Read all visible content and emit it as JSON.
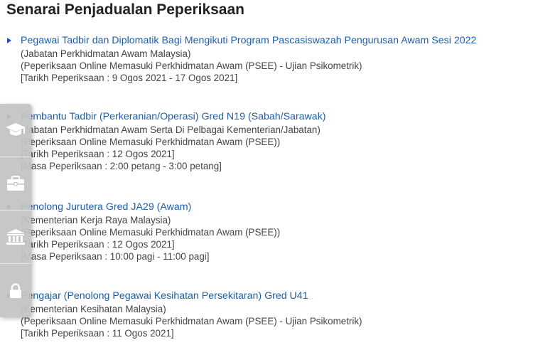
{
  "page": {
    "title": "Senarai Penjadualan Peperiksaan"
  },
  "exams": [
    {
      "title": "Pegawai Tadbir dan Diplomatik Bagi Mengikuti Program Pascasiswazah Pengurusan Awam Sesi 2022",
      "agency": "(Jabatan Perkhidmatan Awam Malaysia)",
      "exam_type": "(Peperiksaan Online Memasuki Perkhidmatan Awam (PSEE) - Ujian Psikometrik)",
      "date": "[Tarikh Peperiksaan : 9 Ogos 2021 - 17 Ogos 2021]",
      "time": ""
    },
    {
      "title": "Pembantu Tadbir (Perkeranian/Operasi) Gred N19 (Sabah/Sarawak)",
      "agency": "(Jabatan Perkhidmatan Awam Serta Di Pelbagai Kementerian/Jabatan)",
      "exam_type": "(Peperiksaan Online Memasuki Perkhidmatan Awam (PSEE))",
      "date": "[Tarikh Peperiksaan : 12 Ogos 2021]",
      "time": "[Masa Peperiksaan : 2:00 petang - 3:00 petang]"
    },
    {
      "title": "Penolong Jurutera Gred JA29 (Awam)",
      "agency": "(Kementerian Kerja Raya Malaysia)",
      "exam_type": "(Peperiksaan Online Memasuki Perkhidmatan Awam (PSEE))",
      "date": "[Tarikh Peperiksaan : 12 Ogos 2021]",
      "time": "[Masa Peperiksaan : 10:00 pagi - 11:00 pagi]"
    },
    {
      "title": "Pengajar (Penolong Pegawai Kesihatan Persekitaran) Gred U41",
      "agency": "(Kementerian Kesihatan Malaysia)",
      "exam_type": "(Peperiksaan Online Memasuki Perkhidmatan Awam (PSEE) - Ujian Psikometrik)",
      "date": "[Tarikh Peperiksaan : 11 Ogos 2021]",
      "time": ""
    }
  ],
  "side_toolbar": {
    "items": [
      {
        "icon": "graduation-cap-icon"
      },
      {
        "icon": "briefcase-icon"
      },
      {
        "icon": "bank-building-icon"
      },
      {
        "icon": "lock-icon"
      }
    ]
  },
  "colors": {
    "link": "#1d5ea8",
    "marker": "#2a4fa8",
    "text": "#444444",
    "toolbar_bg": "#c3c3c3"
  }
}
